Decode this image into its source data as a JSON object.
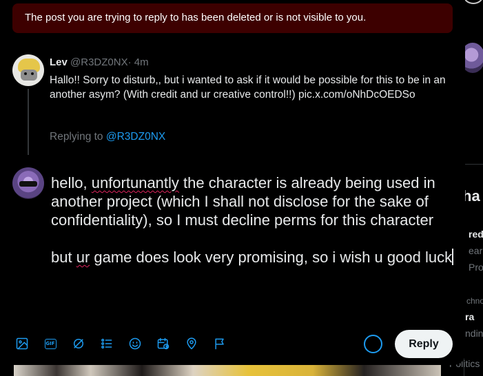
{
  "alert": {
    "message": "The post you are trying to reply to has been deleted or is not visible to you."
  },
  "original_post": {
    "name": "Lev",
    "handle": "@R3DZ0NX",
    "separator": "·",
    "time": "4m",
    "body": "Hallo!! Sorry to disturb,, but i wanted to ask if it would be possible for this to be in an another asym? (With credit and ur creative control!!) pic.x.com/oNhDcOEDSo",
    "replying_prefix": "Replying to",
    "replying_to": "@R3DZ0NX"
  },
  "compose": {
    "p1_a": "hello, ",
    "p1_misspelled": "unfortunantly",
    "p1_b": " the character is already being used in another project (which I shall not disclose for the sake of confidentiality), so I must decline perms for this character",
    "p2_a": "but ",
    "p2_misspelled": "ur",
    "p2_b": " game does look very promising, so i wish u good luck"
  },
  "toolbar": {
    "icons": [
      "image-icon",
      "gif-icon",
      "grok-icon",
      "poll-icon",
      "emoji-icon",
      "schedule-icon",
      "location-icon",
      "flag-icon"
    ],
    "gif_label": "GIF"
  },
  "reply_button": {
    "label": "Reply"
  },
  "background": {
    "heading_fragment": "ha",
    "items": [
      "red",
      "ear",
      "Pro",
      "chno",
      "ra",
      "ndin",
      "Politics"
    ]
  },
  "colors": {
    "accent": "#1d9bf0",
    "alert_bg": "#3d0000",
    "muted": "#71767b",
    "text": "#e7e9ea",
    "background": "#000000"
  }
}
